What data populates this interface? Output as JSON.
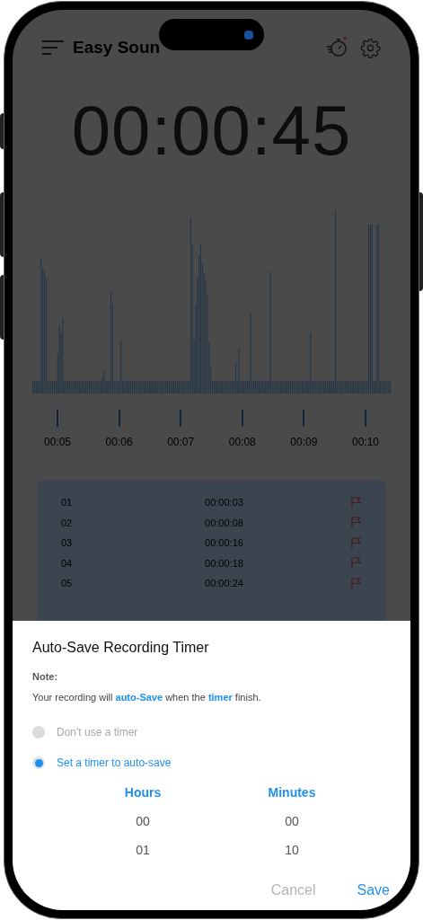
{
  "app_bar": {
    "title": "Easy Soun"
  },
  "elapsed_time": "00:00:45",
  "timeline": [
    "00:05",
    "00:06",
    "00:07",
    "00:08",
    "00:09",
    "00:10"
  ],
  "laps": [
    {
      "number": "01",
      "time": "00:00:03"
    },
    {
      "number": "02",
      "time": "00:00:08"
    },
    {
      "number": "03",
      "time": "00:00:16"
    },
    {
      "number": "04",
      "time": "00:00:18"
    },
    {
      "number": "05",
      "time": "00:00:24"
    }
  ],
  "dialog": {
    "title": "Auto-Save Recording Timer",
    "note_label": "Note:",
    "note": "Your recording will **auto-Save** when the **timer** finish.",
    "options": [
      {
        "label": "Don't use a timer",
        "selected": false
      },
      {
        "label": "Set a timer to auto-save",
        "selected": true
      }
    ],
    "pickers": [
      {
        "label": "Hours",
        "values": [
          "00",
          "01"
        ]
      },
      {
        "label": "Minutes",
        "values": [
          "00",
          "10"
        ]
      }
    ],
    "buttons": [
      {
        "label": "Cancel",
        "kind": "secondary"
      },
      {
        "label": "Save",
        "kind": "primary"
      }
    ]
  }
}
